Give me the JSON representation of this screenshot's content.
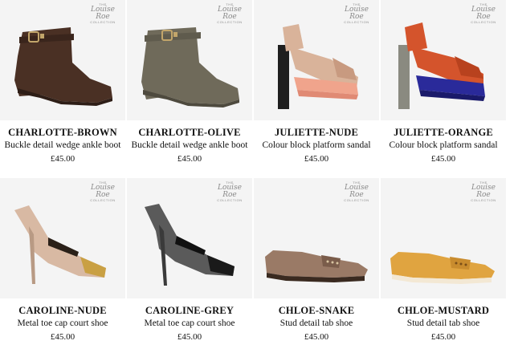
{
  "brand": {
    "the": "THE",
    "name": "Louise Roe",
    "collection": "COLLECTION"
  },
  "products": [
    {
      "name": "CHARLOTTE-BROWN",
      "description": "Buckle detail wedge ankle boot",
      "price": "£45.00"
    },
    {
      "name": "CHARLOTTE-OLIVE",
      "description": "Buckle detail wedge ankle boot",
      "price": "£45.00"
    },
    {
      "name": "JULIETTE-NUDE",
      "description": "Colour block platform sandal",
      "price": "£45.00"
    },
    {
      "name": "JULIETTE-ORANGE",
      "description": "Colour block platform sandal",
      "price": "£45.00"
    },
    {
      "name": "CAROLINE-NUDE",
      "description": "Metal toe cap court shoe",
      "price": "£45.00"
    },
    {
      "name": "CAROLINE-GREY",
      "description": "Metal toe cap court shoe",
      "price": "£45.00"
    },
    {
      "name": "CHLOE-SNAKE",
      "description": "Stud detail tab shoe",
      "price": "£45.00"
    },
    {
      "name": "CHLOE-MUSTARD",
      "description": "Stud detail tab shoe",
      "price": "£45.00"
    }
  ],
  "colors": {
    "charlotte_brown": "#4a3024",
    "charlotte_olive": "#6f6a5a",
    "juliette_nude": "#d9b39a",
    "juliette_nude_sole": "#f0a48c",
    "juliette_orange": "#d4542c",
    "juliette_orange_sole": "#2a2a9a",
    "caroline_nude": "#d8b9a3",
    "caroline_grey": "#5a5a5a",
    "chloe_snake": "#9a7a66",
    "chloe_mustard": "#e0a440"
  }
}
